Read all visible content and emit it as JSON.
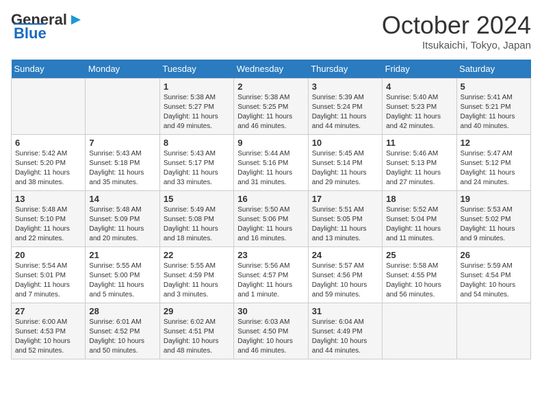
{
  "logo": {
    "text1": "General",
    "text2": "Blue"
  },
  "title": "October 2024",
  "subtitle": "Itsukaichi, Tokyo, Japan",
  "days_of_week": [
    "Sunday",
    "Monday",
    "Tuesday",
    "Wednesday",
    "Thursday",
    "Friday",
    "Saturday"
  ],
  "weeks": [
    [
      {
        "day": "",
        "info": ""
      },
      {
        "day": "",
        "info": ""
      },
      {
        "day": "1",
        "info": "Sunrise: 5:38 AM\nSunset: 5:27 PM\nDaylight: 11 hours and 49 minutes."
      },
      {
        "day": "2",
        "info": "Sunrise: 5:38 AM\nSunset: 5:25 PM\nDaylight: 11 hours and 46 minutes."
      },
      {
        "day": "3",
        "info": "Sunrise: 5:39 AM\nSunset: 5:24 PM\nDaylight: 11 hours and 44 minutes."
      },
      {
        "day": "4",
        "info": "Sunrise: 5:40 AM\nSunset: 5:23 PM\nDaylight: 11 hours and 42 minutes."
      },
      {
        "day": "5",
        "info": "Sunrise: 5:41 AM\nSunset: 5:21 PM\nDaylight: 11 hours and 40 minutes."
      }
    ],
    [
      {
        "day": "6",
        "info": "Sunrise: 5:42 AM\nSunset: 5:20 PM\nDaylight: 11 hours and 38 minutes."
      },
      {
        "day": "7",
        "info": "Sunrise: 5:43 AM\nSunset: 5:18 PM\nDaylight: 11 hours and 35 minutes."
      },
      {
        "day": "8",
        "info": "Sunrise: 5:43 AM\nSunset: 5:17 PM\nDaylight: 11 hours and 33 minutes."
      },
      {
        "day": "9",
        "info": "Sunrise: 5:44 AM\nSunset: 5:16 PM\nDaylight: 11 hours and 31 minutes."
      },
      {
        "day": "10",
        "info": "Sunrise: 5:45 AM\nSunset: 5:14 PM\nDaylight: 11 hours and 29 minutes."
      },
      {
        "day": "11",
        "info": "Sunrise: 5:46 AM\nSunset: 5:13 PM\nDaylight: 11 hours and 27 minutes."
      },
      {
        "day": "12",
        "info": "Sunrise: 5:47 AM\nSunset: 5:12 PM\nDaylight: 11 hours and 24 minutes."
      }
    ],
    [
      {
        "day": "13",
        "info": "Sunrise: 5:48 AM\nSunset: 5:10 PM\nDaylight: 11 hours and 22 minutes."
      },
      {
        "day": "14",
        "info": "Sunrise: 5:48 AM\nSunset: 5:09 PM\nDaylight: 11 hours and 20 minutes."
      },
      {
        "day": "15",
        "info": "Sunrise: 5:49 AM\nSunset: 5:08 PM\nDaylight: 11 hours and 18 minutes."
      },
      {
        "day": "16",
        "info": "Sunrise: 5:50 AM\nSunset: 5:06 PM\nDaylight: 11 hours and 16 minutes."
      },
      {
        "day": "17",
        "info": "Sunrise: 5:51 AM\nSunset: 5:05 PM\nDaylight: 11 hours and 13 minutes."
      },
      {
        "day": "18",
        "info": "Sunrise: 5:52 AM\nSunset: 5:04 PM\nDaylight: 11 hours and 11 minutes."
      },
      {
        "day": "19",
        "info": "Sunrise: 5:53 AM\nSunset: 5:02 PM\nDaylight: 11 hours and 9 minutes."
      }
    ],
    [
      {
        "day": "20",
        "info": "Sunrise: 5:54 AM\nSunset: 5:01 PM\nDaylight: 11 hours and 7 minutes."
      },
      {
        "day": "21",
        "info": "Sunrise: 5:55 AM\nSunset: 5:00 PM\nDaylight: 11 hours and 5 minutes."
      },
      {
        "day": "22",
        "info": "Sunrise: 5:55 AM\nSunset: 4:59 PM\nDaylight: 11 hours and 3 minutes."
      },
      {
        "day": "23",
        "info": "Sunrise: 5:56 AM\nSunset: 4:57 PM\nDaylight: 11 hours and 1 minute."
      },
      {
        "day": "24",
        "info": "Sunrise: 5:57 AM\nSunset: 4:56 PM\nDaylight: 10 hours and 59 minutes."
      },
      {
        "day": "25",
        "info": "Sunrise: 5:58 AM\nSunset: 4:55 PM\nDaylight: 10 hours and 56 minutes."
      },
      {
        "day": "26",
        "info": "Sunrise: 5:59 AM\nSunset: 4:54 PM\nDaylight: 10 hours and 54 minutes."
      }
    ],
    [
      {
        "day": "27",
        "info": "Sunrise: 6:00 AM\nSunset: 4:53 PM\nDaylight: 10 hours and 52 minutes."
      },
      {
        "day": "28",
        "info": "Sunrise: 6:01 AM\nSunset: 4:52 PM\nDaylight: 10 hours and 50 minutes."
      },
      {
        "day": "29",
        "info": "Sunrise: 6:02 AM\nSunset: 4:51 PM\nDaylight: 10 hours and 48 minutes."
      },
      {
        "day": "30",
        "info": "Sunrise: 6:03 AM\nSunset: 4:50 PM\nDaylight: 10 hours and 46 minutes."
      },
      {
        "day": "31",
        "info": "Sunrise: 6:04 AM\nSunset: 4:49 PM\nDaylight: 10 hours and 44 minutes."
      },
      {
        "day": "",
        "info": ""
      },
      {
        "day": "",
        "info": ""
      }
    ]
  ]
}
